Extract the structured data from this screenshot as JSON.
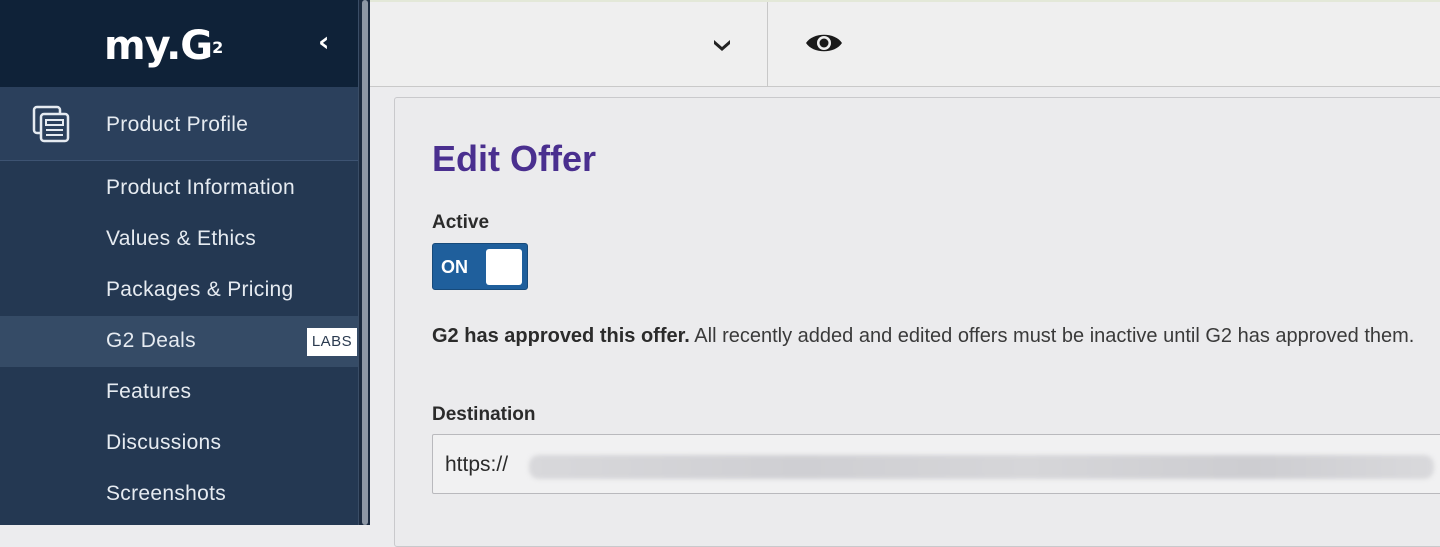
{
  "sidebar": {
    "logo_text": "my.G",
    "logo_sup": "2",
    "collapse_glyph": "‹",
    "section": {
      "label": "Product Profile",
      "icon": "product-profile-icon"
    },
    "items": [
      {
        "label": "Product Information"
      },
      {
        "label": "Values & Ethics"
      },
      {
        "label": "Packages & Pricing"
      },
      {
        "label": "G2 Deals",
        "badge": "LABS",
        "active": true
      },
      {
        "label": "Features"
      },
      {
        "label": "Discussions"
      },
      {
        "label": "Screenshots"
      }
    ]
  },
  "topbar": {
    "dropdown_icon": "chevron-down-icon",
    "preview_icon": "eye-icon"
  },
  "offer": {
    "title": "Edit Offer",
    "active_label": "Active",
    "toggle_text": "ON",
    "approval_bold": "G2 has approved this offer.",
    "approval_text": " All recently added and edited offers must be inactive until G2 has approved them.",
    "destination_label": "Destination",
    "destination_prefix": "https://"
  },
  "colors": {
    "sidebar_bg": "#243852",
    "brand_bg": "#0f2238",
    "title": "#4a2f8f",
    "toggle_on": "#1f5f9c"
  }
}
